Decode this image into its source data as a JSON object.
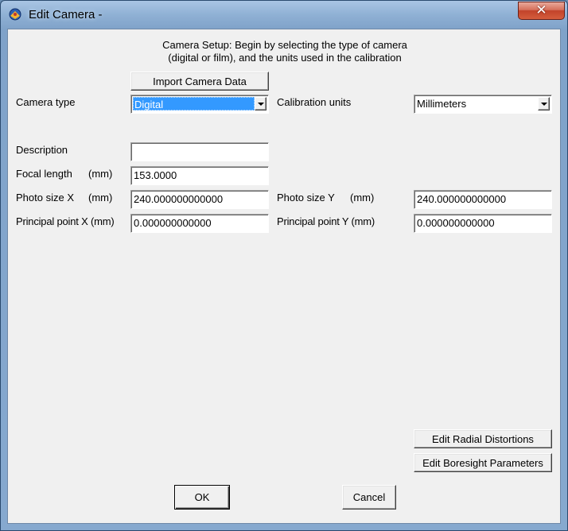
{
  "window": {
    "title": "Edit Camera -",
    "close_glyph": "✕"
  },
  "header": {
    "line1": "Camera Setup:  Begin by selecting the type of camera",
    "line2": "(digital or film), and the units used in the calibration"
  },
  "buttons": {
    "import": "Import Camera Data",
    "edit_radial": "Edit Radial Distortions",
    "edit_boresight": "Edit Boresight Parameters",
    "ok": "OK",
    "cancel": "Cancel"
  },
  "camera_type": {
    "label": "Camera type",
    "value": "Digital"
  },
  "calibration_units": {
    "label": "Calibration units",
    "value": "Millimeters"
  },
  "description": {
    "label": "Description",
    "value": ""
  },
  "focal_length": {
    "label": "Focal length",
    "unit": "(mm)",
    "value": "153.0000"
  },
  "photo_size_x": {
    "label": "Photo size X",
    "unit": "(mm)",
    "value": "240.000000000000"
  },
  "photo_size_y": {
    "label": "Photo size Y",
    "unit": "(mm)",
    "value": "240.000000000000"
  },
  "principal_point_x": {
    "label": "Principal point X (mm)",
    "value": "0.000000000000"
  },
  "principal_point_y": {
    "label": "Principal point Y (mm)",
    "value": "0.000000000000"
  },
  "colors": {
    "selection": "#3399ff",
    "dialog_bg": "#f0f0f0",
    "close_button": "#c2432a"
  },
  "icons": {
    "app": "camera-app-icon",
    "close": "close-icon",
    "dropdown": "chevron-down-icon"
  }
}
